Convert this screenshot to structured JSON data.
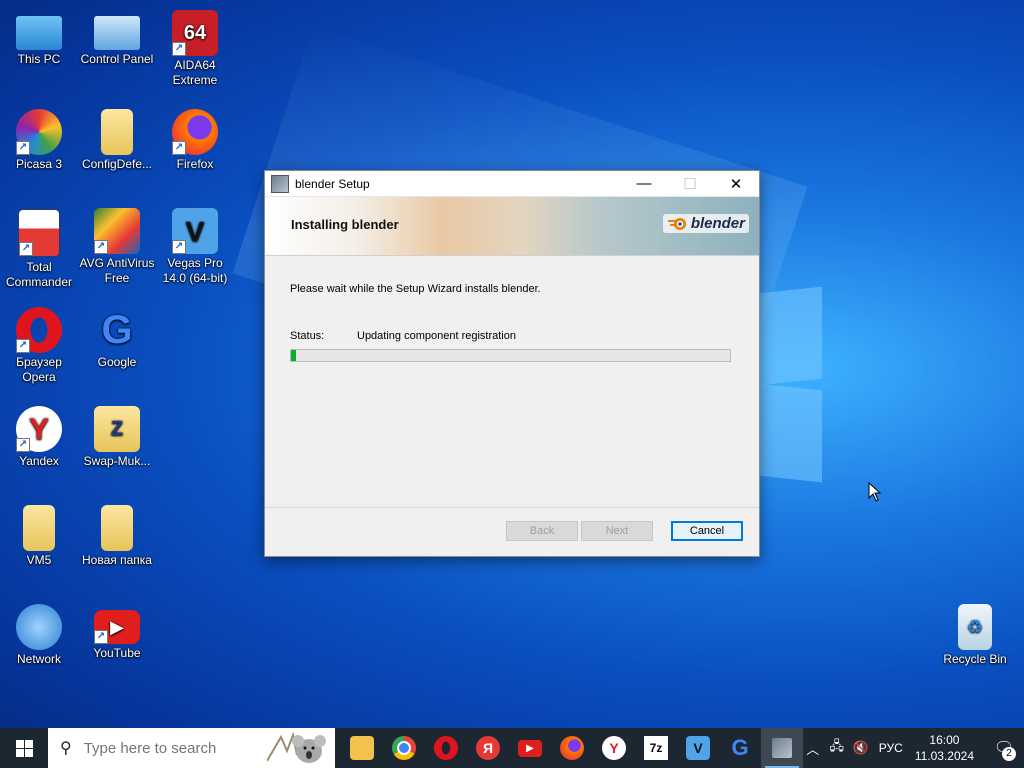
{
  "desktop": {
    "icons": [
      {
        "label": "This PC"
      },
      {
        "label": "Control Panel"
      },
      {
        "label": "AIDA64 Extreme"
      },
      {
        "label": "Picasa 3"
      },
      {
        "label": "ConfigDefe..."
      },
      {
        "label": "Firefox"
      },
      {
        "label": "Total Commander"
      },
      {
        "label": "AVG AntiVirus Free"
      },
      {
        "label": "Vegas Pro 14.0 (64-bit)"
      },
      {
        "label": "Браузер Opera"
      },
      {
        "label": "Google"
      },
      {
        "label": "Yandex"
      },
      {
        "label": "Swap-Muk..."
      },
      {
        "label": "VM5"
      },
      {
        "label": "Новая папка"
      },
      {
        "label": "Network"
      },
      {
        "label": "YouTube"
      },
      {
        "label": "Recycle Bin"
      }
    ]
  },
  "dialog": {
    "title": "blender Setup",
    "minimize": "—",
    "maximize": "☐",
    "close": "✕",
    "heading": "Installing blender",
    "logo_text": "blender",
    "message": "Please wait while the Setup Wizard installs blender.",
    "status_label": "Status:",
    "status_value": "Updating component registration",
    "progress": 0.012,
    "back_label": "Back",
    "next_label": "Next",
    "cancel_label": "Cancel"
  },
  "taskbar": {
    "search_placeholder": "Type here to search",
    "apps": [
      "file-explorer",
      "chrome",
      "opera",
      "yandex-music",
      "youtube",
      "firefox",
      "yandex-browser",
      "7zip",
      "vegas",
      "google",
      "blender-setup"
    ],
    "tray_lang": "РУС",
    "time": "16:00",
    "date": "11.03.2024",
    "notifications": "2"
  },
  "colors": {
    "accent": "#0078d7",
    "progress": "#06b025",
    "taskbar": "#1c2731"
  }
}
